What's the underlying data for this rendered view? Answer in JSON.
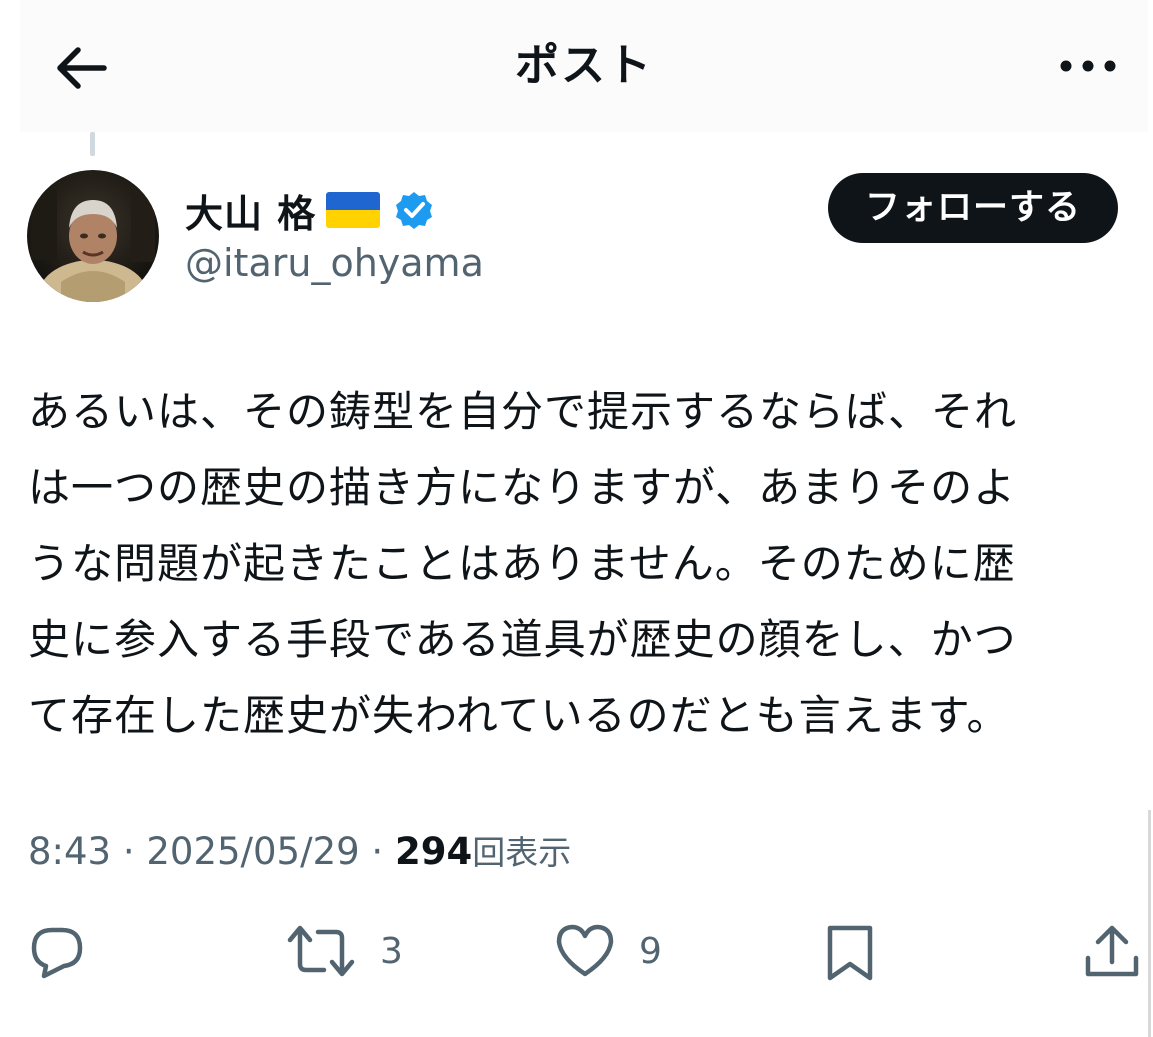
{
  "header": {
    "title": "ポスト",
    "back_icon": "arrow-left-icon",
    "more_icon": "more-horizontal-icon"
  },
  "author": {
    "display_name": "大山 格",
    "handle": "@itaru_ohyama",
    "flag_icon": "ukraine-flag-icon",
    "verified_icon": "verified-badge-icon",
    "verified_color": "#1d9bf0"
  },
  "follow_button": {
    "label": "フォローする"
  },
  "post": {
    "lines": [
      "あるいは、その鋳型を自分で提示するならば、それ",
      "は一つの歴史の描き方になりますが、あまりそのよ",
      "うな問題が起きたことはありません。そのために歴",
      "史に参入する手段である道具が歴史の顔をし、かつ",
      "て存在した歴史が失われているのだとも言えます。"
    ]
  },
  "meta": {
    "time": "8:43",
    "separator": "·",
    "date": "2025/05/29",
    "views_count": "294",
    "views_label": "回表示"
  },
  "actions": {
    "retweet_count": "3",
    "like_count": "9"
  },
  "colors": {
    "text": "#0f1419",
    "secondary": "#536471",
    "button_bg": "#0f1419"
  }
}
